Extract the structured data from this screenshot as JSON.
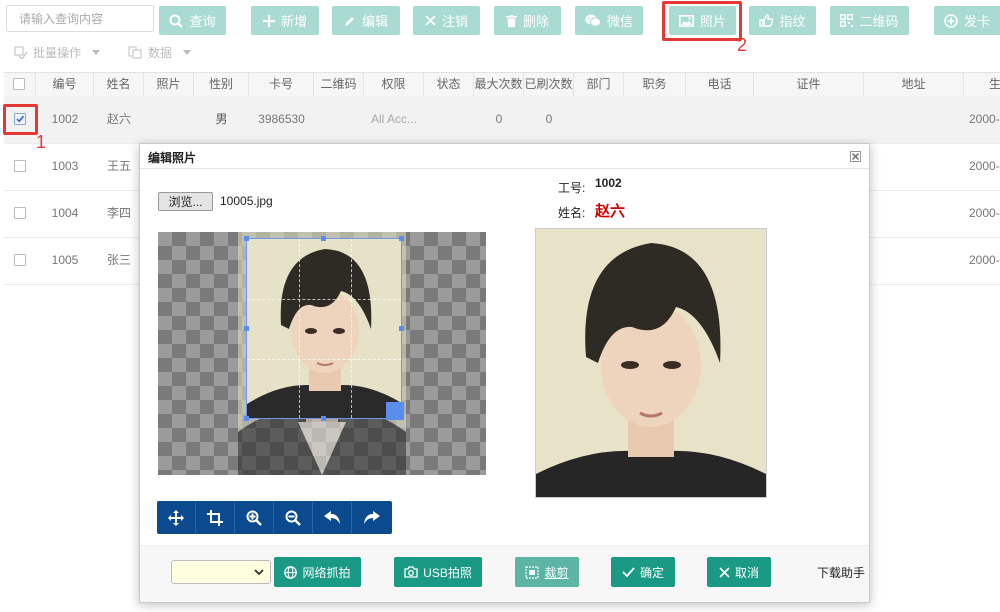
{
  "search": {
    "placeholder": "请输入查询内容",
    "query_label": "查询"
  },
  "toolbar": [
    {
      "id": "add",
      "label": "新增",
      "icon": "plus-icon"
    },
    {
      "id": "edit",
      "label": "编辑",
      "icon": "pencil-icon"
    },
    {
      "id": "cancel",
      "label": "注销",
      "icon": "x-icon"
    },
    {
      "id": "delete",
      "label": "删除",
      "icon": "trash-icon"
    },
    {
      "id": "wechat",
      "label": "微信",
      "icon": "wechat-icon"
    },
    {
      "id": "photo",
      "label": "照片",
      "icon": "image-icon"
    },
    {
      "id": "fingerprint",
      "label": "指纹",
      "icon": "thumb-icon"
    },
    {
      "id": "qrcode",
      "label": "二维码",
      "icon": "qrcode-icon"
    },
    {
      "id": "issue",
      "label": "发卡",
      "icon": "plus-circle-icon"
    }
  ],
  "subbar": {
    "batch_label": "批量操作",
    "data_label": "数据"
  },
  "annotations": {
    "step1": "1",
    "step2": "2"
  },
  "columns": [
    "编号",
    "姓名",
    "照片",
    "性别",
    "卡号",
    "二维码",
    "权限",
    "状态",
    "最大次数",
    "已刷次数",
    "部门",
    "职务",
    "电话",
    "证件",
    "地址",
    "生"
  ],
  "rows": [
    {
      "id": "1002",
      "name": "赵六",
      "gender": "男",
      "card": "3986530",
      "perm": "All Acc...",
      "max": "0",
      "used": "0",
      "date": "2000-",
      "checked": true
    },
    {
      "id": "1003",
      "name": "王五",
      "date": "2000-",
      "checked": false
    },
    {
      "id": "1004",
      "name": "李四",
      "date": "2000-",
      "checked": false
    },
    {
      "id": "1005",
      "name": "张三",
      "date": "2000-",
      "checked": false
    }
  ],
  "dialog": {
    "title": "编辑照片",
    "browse_label": "浏览...",
    "filename": "10005.jpg",
    "employee_id_label": "工号:",
    "employee_id": "1002",
    "name_label": "姓名:",
    "name": "赵六",
    "footer": {
      "network_capture": "网络抓拍",
      "usb_capture": "USB拍照",
      "crop": "裁剪",
      "confirm": "确定",
      "cancel": "取消",
      "download_helper": "下载助手"
    }
  },
  "colors": {
    "toolbar_button": "#aadbd2",
    "footer_button": "#1a9a84",
    "tool_bar": "#0b4a8f",
    "annotation": "#e53935",
    "name_red": "#cc0000"
  }
}
